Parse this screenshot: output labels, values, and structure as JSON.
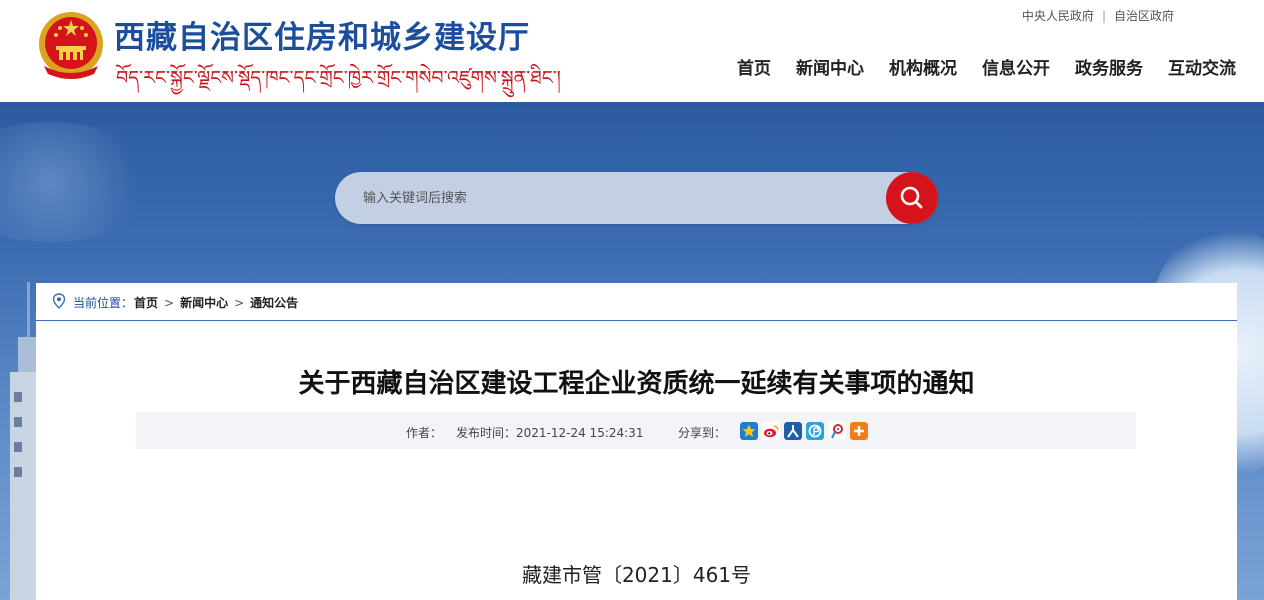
{
  "header": {
    "title": "西藏自治区住房和城乡建设厅",
    "subtitle": "བོད་རང་སྐྱོང་ལྗོངས་སྡོད་ཁང་དང་གྲོང་ཁྱེར་གྲོང་གསེབ་འཛུགས་སྐྲུན་ཐིང་།",
    "top_links": [
      "中央人民政府",
      "自治区政府"
    ],
    "nav": [
      "首页",
      "新闻中心",
      "机构概况",
      "信息公开",
      "政务服务",
      "互动交流"
    ]
  },
  "search": {
    "placeholder": "输入关键词后搜索",
    "icon": "search-icon"
  },
  "breadcrumb": {
    "label": "当前位置：",
    "items": [
      "首页",
      "新闻中心",
      "通知公告"
    ]
  },
  "article": {
    "title": "关于西藏自治区建设工程企业资质统一延续有关事项的通知",
    "author_label": "作者：",
    "time": "发布时间：2021-12-24 15:24:31",
    "share_label": "分享到：",
    "doc_number": "藏建市管〔2021〕461号"
  },
  "share_icons": [
    {
      "name": "qzone-icon",
      "color": "#f2b21b"
    },
    {
      "name": "weibo-icon",
      "color": "#e6162d"
    },
    {
      "name": "renren-icon",
      "color": "#1d5ea8"
    },
    {
      "name": "pengyou-icon",
      "color": "#2ba3e0"
    },
    {
      "name": "tencent-weibo-icon",
      "color": "#d9242a"
    },
    {
      "name": "more-icon",
      "color": "#f07d1a"
    }
  ],
  "colors": {
    "brand_blue": "#1b4e9c",
    "brand_red": "#d4131b"
  }
}
